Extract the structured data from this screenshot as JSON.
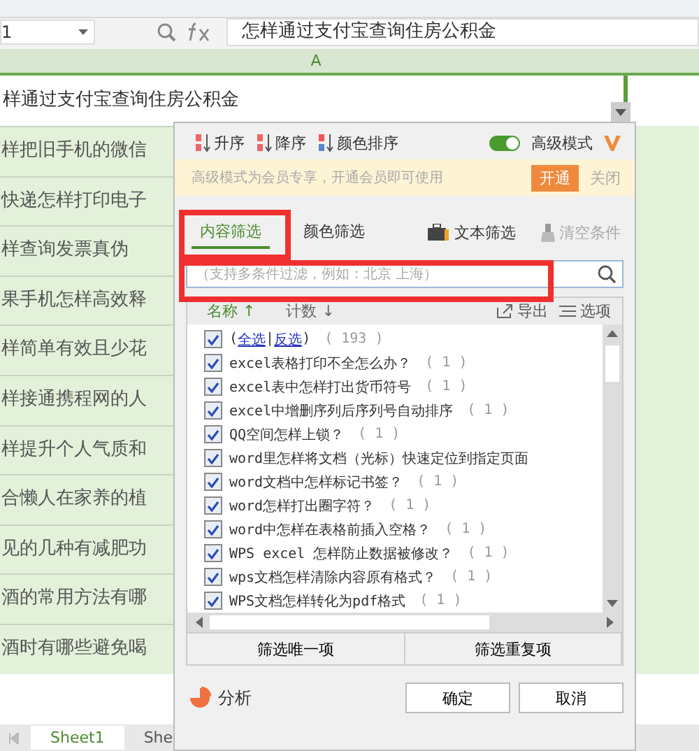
{
  "formula_bar": {
    "cell_ref": "1",
    "formula": "怎样通过支付宝查询住房公积金"
  },
  "column_header": "A",
  "title_row": "样通过支付宝查询住房公积金",
  "rows": [
    "样把旧手机的微信",
    "快递怎样打印电子",
    "样查询发票真伪",
    "果手机怎样高效释",
    "样简单有效且少花",
    "样接通携程网的人",
    "样提升个人气质和",
    "合懒人在家养的植",
    "见的几种有减肥功",
    "酒的常用方法有哪",
    "酒时有哪些避免喝"
  ],
  "sheet_tabs": [
    {
      "label": "Sheet1",
      "selected": true
    },
    {
      "label": "She",
      "selected": false
    }
  ],
  "filter_dialog": {
    "sort_buttons": [
      "升序",
      "降序",
      "颜色排序"
    ],
    "advanced_mode": {
      "label": "高级模式",
      "on": true
    },
    "banner": {
      "text": "高级模式为会员专享，开通会员即可使用",
      "action": "开通",
      "close": "关闭"
    },
    "tabs": [
      {
        "label": "内容筛选",
        "selected": true
      },
      {
        "label": "颜色筛选",
        "selected": false
      }
    ],
    "text_filter": "文本筛选",
    "clear": {
      "label": "清空条件",
      "disabled": true
    },
    "search": {
      "placeholder": "（支持多条件过滤，例如：北京 上海）"
    },
    "list_header": [
      {
        "label": "名称",
        "arrow": "↑",
        "selected": true
      },
      {
        "label": "计数",
        "arrow": "↓",
        "selected": false
      }
    ],
    "export": "导出",
    "options": "选项",
    "items": [
      {
        "kind": "all",
        "open": "(",
        "links": [
          "全选",
          "反选"
        ],
        "sep": "|",
        "close": ")",
        "count": "( 193 )",
        "checked": true
      },
      {
        "kind": "item",
        "text": "excel表格打印不全怎么办？",
        "count": "( 1 )",
        "checked": true
      },
      {
        "kind": "item",
        "text": "excel表中怎样打出货币符号",
        "count": "( 1 )",
        "checked": true
      },
      {
        "kind": "item",
        "text": "excel中增删序列后序列号自动排序",
        "count": "( 1 )",
        "checked": true
      },
      {
        "kind": "item",
        "text": "QQ空间怎样上锁？",
        "count": "( 1 )",
        "checked": true
      },
      {
        "kind": "item",
        "text": "word里怎样将文档（光标）快速定位到指定页面",
        "checked": true
      },
      {
        "kind": "item",
        "text": "word文档中怎样标记书签？",
        "count": "( 1 )",
        "checked": true
      },
      {
        "kind": "item",
        "text": "word怎样打出圈字符？",
        "count": "( 1 )",
        "checked": true
      },
      {
        "kind": "item",
        "text": "word中怎样在表格前插入空格？",
        "count": "( 1 )",
        "checked": true
      },
      {
        "kind": "item",
        "text": "WPS excel 怎样防止数据被修改？",
        "count": "( 1 )",
        "checked": true
      },
      {
        "kind": "item",
        "text": "wps文档怎样清除内容原有格式？",
        "count": "( 1 )",
        "checked": true
      },
      {
        "kind": "item",
        "text": "WPS文档怎样转化为pdf格式",
        "count": "( 1 )",
        "checked": true
      }
    ],
    "filter_buttons": [
      "筛选唯一项",
      "筛选重复项"
    ],
    "analyze": "分析",
    "ok": "确定",
    "cancel": "取消"
  }
}
